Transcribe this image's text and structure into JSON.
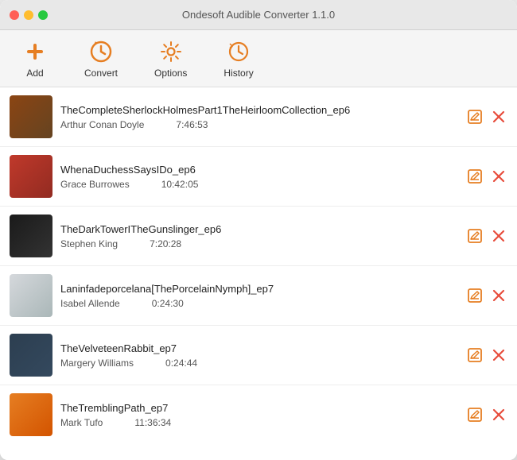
{
  "window": {
    "title": "Ondesoft Audible Converter 1.1.0"
  },
  "toolbar": {
    "add_label": "Add",
    "convert_label": "Convert",
    "options_label": "Options",
    "history_label": "History"
  },
  "items": [
    {
      "id": 1,
      "cover_class": "cover-1",
      "title": "TheCompleteSherlockHolmesPart1TheHeirloomCollection_ep6",
      "author": "Arthur Conan Doyle",
      "duration": "7:46:53"
    },
    {
      "id": 2,
      "cover_class": "cover-2",
      "title": "WhenaDuchessSaysIDo_ep6",
      "author": "Grace Burrowes",
      "duration": "10:42:05"
    },
    {
      "id": 3,
      "cover_class": "cover-3",
      "title": "TheDarkTowerITheGunslinger_ep6",
      "author": "Stephen King",
      "duration": "7:20:28"
    },
    {
      "id": 4,
      "cover_class": "cover-4",
      "title": "Laninfadeporcelana[ThePorcelainNymph]_ep7",
      "author": "Isabel Allende",
      "duration": "0:24:30"
    },
    {
      "id": 5,
      "cover_class": "cover-5",
      "title": "TheVelveteenRabbit_ep7",
      "author": "Margery Williams",
      "duration": "0:24:44"
    },
    {
      "id": 6,
      "cover_class": "cover-6",
      "title": "TheTremblingPath_ep7",
      "author": "Mark Tufo",
      "duration": "11:36:34"
    }
  ],
  "colors": {
    "accent_orange": "#e67e22",
    "accent_red": "#e74c3c"
  }
}
